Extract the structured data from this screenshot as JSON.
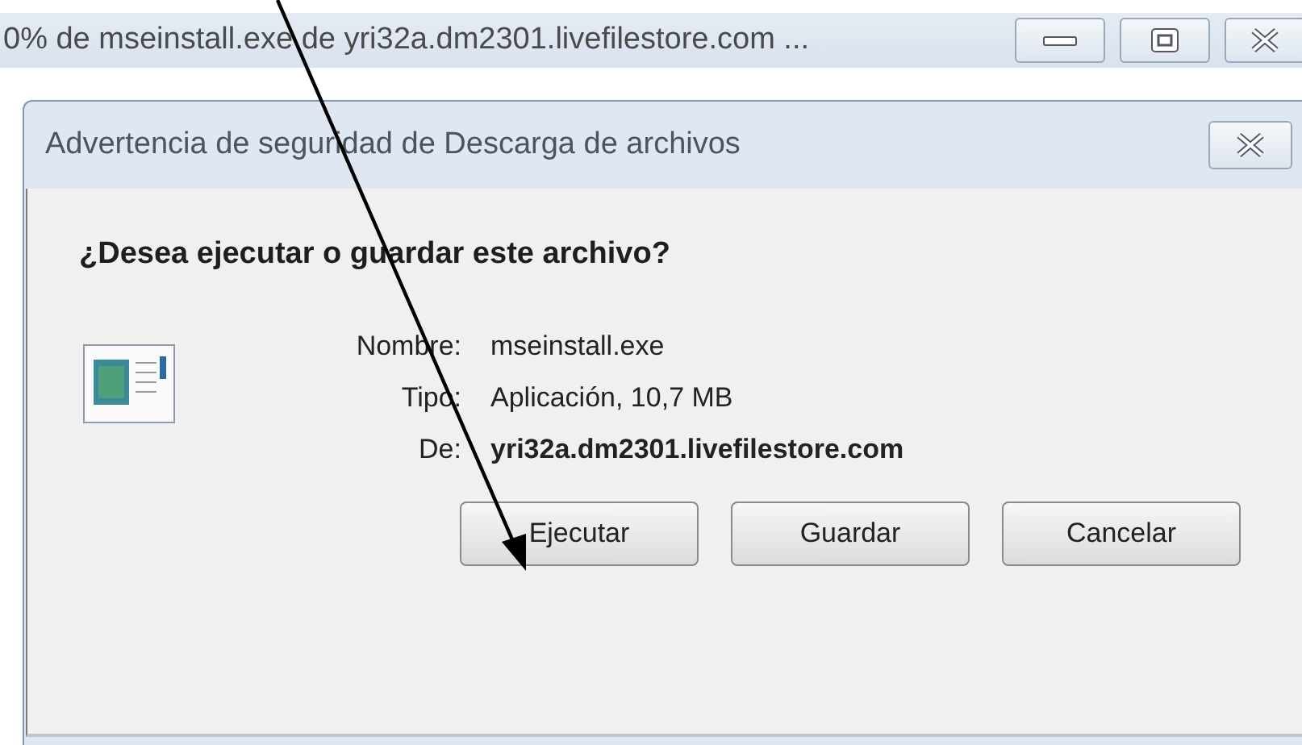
{
  "download_window": {
    "title": "0% de mseinstall.exe de yri32a.dm2301.livefilestore.com ..."
  },
  "dialog": {
    "title": "Advertencia de seguridad de Descarga de archivos",
    "question": "¿Desea ejecutar o guardar este archivo?",
    "fields": [
      {
        "label": "Nombre:",
        "value": "mseinstall.exe",
        "bold": false
      },
      {
        "label": "Tipo:",
        "value": "Aplicación, 10,7 MB",
        "bold": false
      },
      {
        "label": "De:",
        "value": "yri32a.dm2301.livefilestore.com",
        "bold": true
      }
    ],
    "buttons": [
      "Ejecutar",
      "Guardar",
      "Cancelar"
    ]
  }
}
